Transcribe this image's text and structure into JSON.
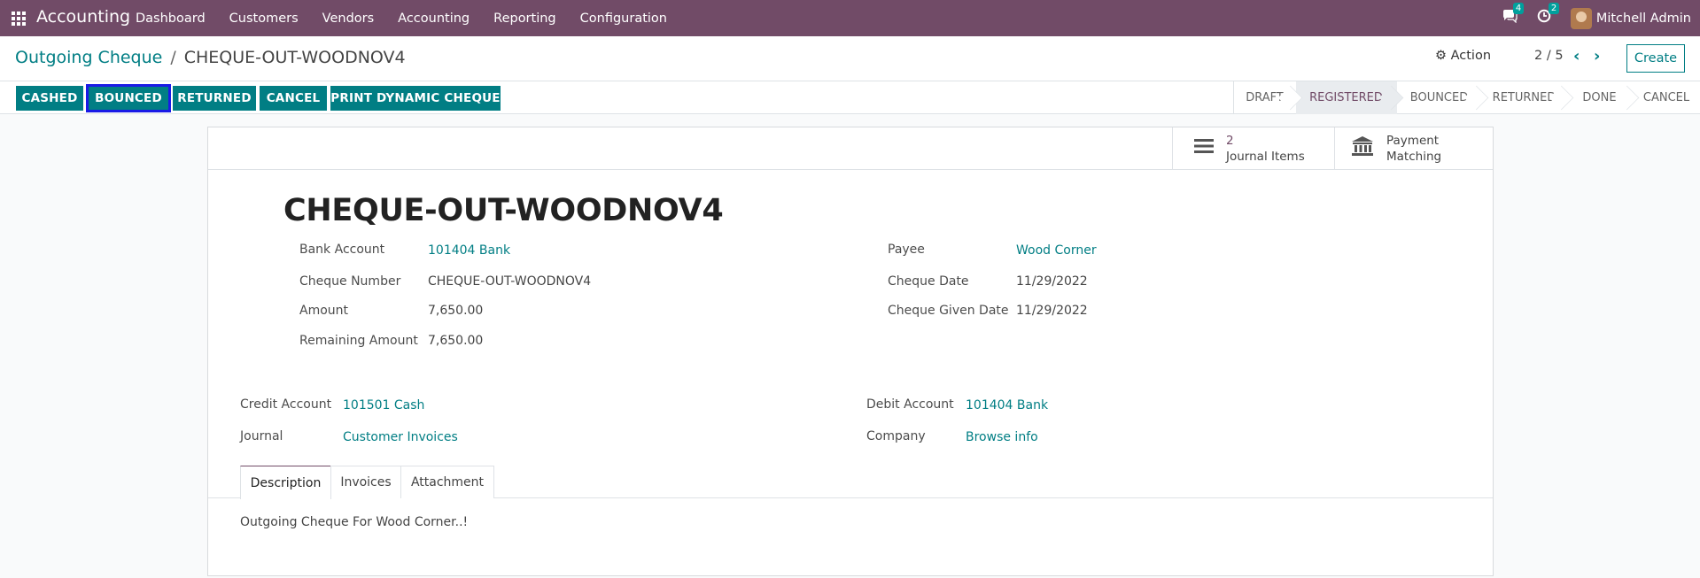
{
  "navbar": {
    "app_name": "Accounting",
    "menu": [
      "Dashboard",
      "Customers",
      "Vendors",
      "Accounting",
      "Reporting",
      "Configuration"
    ],
    "messages_count": "4",
    "activities_count": "2",
    "user_name": "Mitchell Admin"
  },
  "breadcrumb": {
    "parent": "Outgoing Cheque",
    "separator": "/",
    "current": "CHEQUE-OUT-WOODNOV4"
  },
  "control": {
    "action_label": "Action",
    "pager": "2 / 5",
    "create_label": "Create"
  },
  "header_buttons": [
    "CASHED",
    "BOUNCED",
    "RETURNED",
    "CANCEL",
    "PRINT DYNAMIC CHEQUE"
  ],
  "stages": [
    "DRAFT",
    "REGISTERED",
    "BOUNCED",
    "RETURNED",
    "DONE",
    "CANCEL"
  ],
  "active_stage": "REGISTERED",
  "smart_buttons": {
    "journal_items_count": "2",
    "journal_items_label": "Journal Items",
    "payment_label_1": "Payment",
    "payment_label_2": "Matching"
  },
  "record": {
    "title": "CHEQUE-OUT-WOODNOV4",
    "bank_account_label": "Bank Account",
    "bank_account": "101404 Bank",
    "cheque_number_label": "Cheque Number",
    "cheque_number": "CHEQUE-OUT-WOODNOV4",
    "amount_label": "Amount",
    "amount": "7,650.00",
    "remaining_amount_label": "Remaining Amount",
    "remaining_amount": "7,650.00",
    "payee_label": "Payee",
    "payee": "Wood Corner",
    "cheque_date_label": "Cheque Date",
    "cheque_date": "11/29/2022",
    "cheque_given_date_label": "Cheque Given Date",
    "cheque_given_date": "11/29/2022",
    "credit_account_label": "Credit Account",
    "credit_account": "101501 Cash",
    "journal_label": "Journal",
    "journal": "Customer Invoices",
    "debit_account_label": "Debit Account",
    "debit_account": "101404 Bank",
    "company_label": "Company",
    "company": "Browse info"
  },
  "tabs": [
    "Description",
    "Invoices",
    "Attachment"
  ],
  "description": "Outgoing Cheque For Wood Corner..!",
  "colors": {
    "navbar": "#714b67",
    "primary": "#017e84",
    "focus_outline": "#1a1ae6"
  }
}
